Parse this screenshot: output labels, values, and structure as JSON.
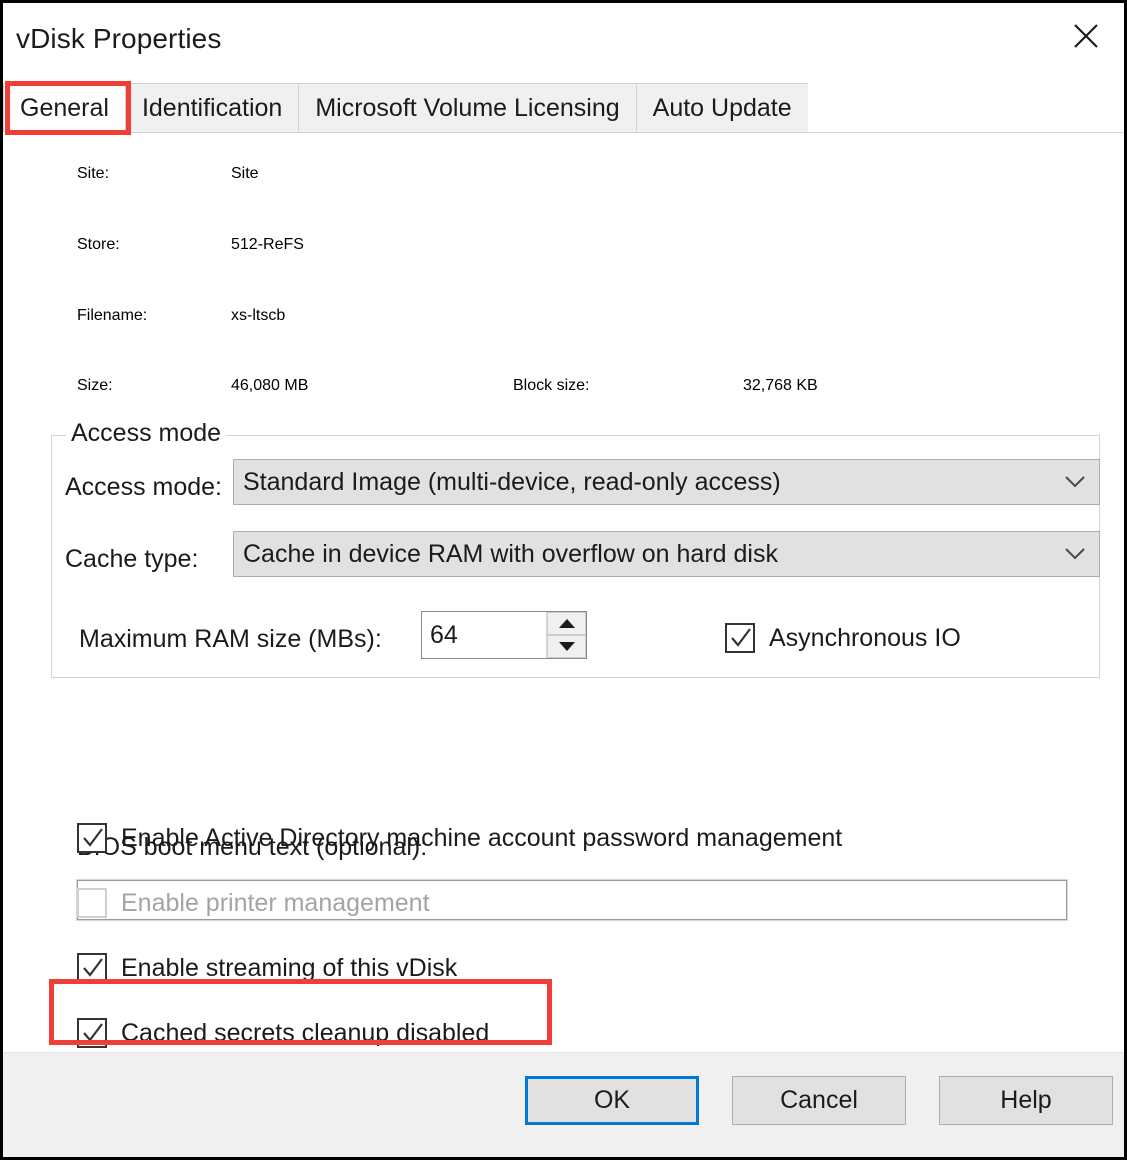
{
  "window": {
    "title": "vDisk Properties",
    "close_icon": "close-icon"
  },
  "tabs": [
    {
      "label": "General",
      "active": true
    },
    {
      "label": "Identification",
      "active": false
    },
    {
      "label": "Microsoft Volume Licensing",
      "active": false
    },
    {
      "label": "Auto Update",
      "active": false
    }
  ],
  "general": {
    "site_label": "Site:",
    "site_value": "Site",
    "store_label": "Store:",
    "store_value": "512-ReFS",
    "filename_label": "Filename:",
    "filename_value": "xs-ltscb",
    "size_label": "Size:",
    "size_value": "46,080 MB",
    "block_size_label": "Block size:",
    "block_size_value": "32,768 KB"
  },
  "access_mode_group": {
    "legend": "Access mode",
    "access_mode_label": "Access mode:",
    "access_mode_value": "Standard Image (multi-device, read-only access)",
    "cache_type_label": "Cache type:",
    "cache_type_value": "Cache in device RAM with overflow on hard disk",
    "max_ram_label": "Maximum RAM size (MBs):",
    "max_ram_value": "64",
    "async_io_label": "Asynchronous IO",
    "async_io_checked": true
  },
  "bios": {
    "label": "BIOS boot menu text (optional):",
    "value": "",
    "placeholder": ""
  },
  "options": [
    {
      "label": "Enable Active Directory machine account password management",
      "checked": true,
      "enabled": true
    },
    {
      "label": "Enable printer management",
      "checked": false,
      "enabled": false
    },
    {
      "label": "Enable streaming of this vDisk",
      "checked": true,
      "enabled": true
    },
    {
      "label": "Cached secrets cleanup disabled",
      "checked": true,
      "enabled": true
    }
  ],
  "buttons": {
    "ok": "OK",
    "cancel": "Cancel",
    "help": "Help"
  },
  "annotations": {
    "highlight_color": "#ef3e36",
    "highlighted": [
      "General",
      "Cached secrets cleanup disabled"
    ]
  },
  "colors": {
    "accent": "#0078d7",
    "highlight": "#ef3e36",
    "control_face": "#e1e1e1",
    "footer": "#f0f0f0"
  }
}
